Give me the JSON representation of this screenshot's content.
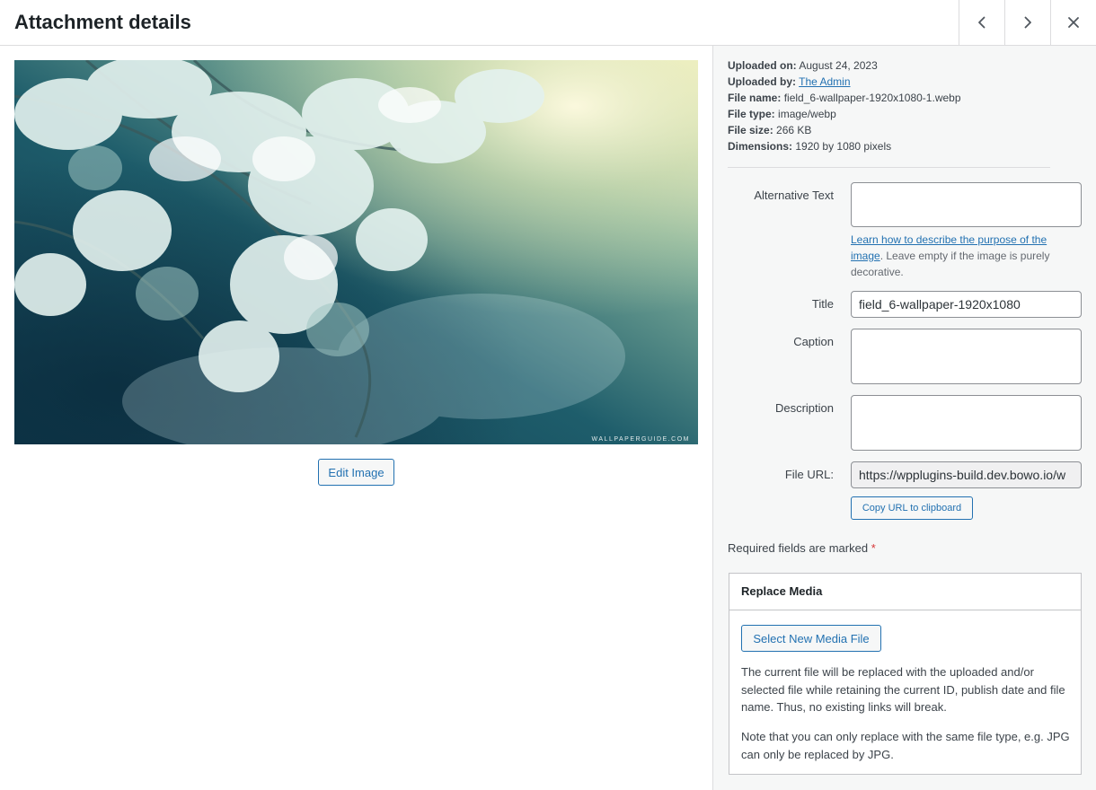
{
  "header": {
    "title": "Attachment details",
    "prev_icon": "chevron-left-icon",
    "next_icon": "chevron-right-icon",
    "close_icon": "close-icon"
  },
  "preview": {
    "watermark": "WALLPAPERGUIDE.COM",
    "edit_label": "Edit Image"
  },
  "meta": {
    "uploaded_on_label": "Uploaded on:",
    "uploaded_on": "August 24, 2023",
    "uploaded_by_label": "Uploaded by:",
    "uploaded_by": "The Admin",
    "file_name_label": "File name:",
    "file_name": "field_6-wallpaper-1920x1080-1.webp",
    "file_type_label": "File type:",
    "file_type": "image/webp",
    "file_size_label": "File size:",
    "file_size": "266 KB",
    "dimensions_label": "Dimensions:",
    "dimensions": "1920 by 1080 pixels"
  },
  "fields": {
    "alt_label": "Alternative Text",
    "alt_value": "",
    "alt_help_link": "Learn how to describe the purpose of the image",
    "alt_help_rest": ". Leave empty if the image is purely decorative.",
    "title_label": "Title",
    "title_value": "field_6-wallpaper-1920x1080",
    "caption_label": "Caption",
    "caption_value": "",
    "description_label": "Description",
    "description_value": "",
    "url_label": "File URL:",
    "url_value": "https://wpplugins-build.dev.bowo.io/w",
    "copy_label": "Copy URL to clipboard"
  },
  "required_note": {
    "text": "Required fields are marked",
    "star": "*"
  },
  "replace_media": {
    "title": "Replace Media",
    "button_label": "Select New Media File",
    "paragraph_1": "The current file will be replaced with the uploaded and/or selected file while retaining the current ID, publish date and file name. Thus, no existing links will break.",
    "paragraph_2": "Note that you can only replace with the same file type, e.g. JPG can only be replaced by JPG."
  },
  "colors": {
    "accent": "#2271b1",
    "required": "#d63638",
    "sidebar_bg": "#f6f7f7",
    "border": "#dcdcde"
  }
}
